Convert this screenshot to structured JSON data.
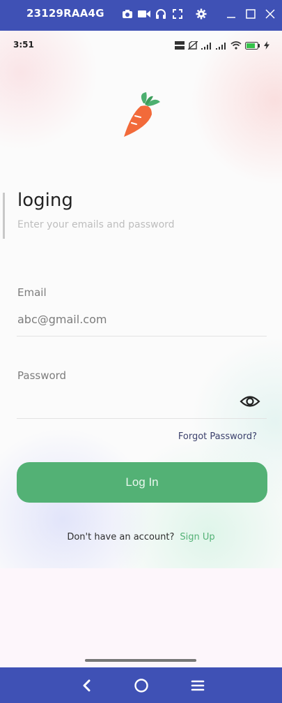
{
  "device": {
    "name": "23129RAA4G",
    "tools": [
      "camera-icon",
      "video-icon",
      "headset-icon",
      "fullscreen-icon",
      "settings-icon"
    ],
    "window_controls": [
      "minimize-icon",
      "maximize-icon",
      "close-icon"
    ]
  },
  "status_bar": {
    "time": "3:51",
    "icons": [
      "data-speed-icon",
      "sim-off-icon",
      "signal-icon",
      "signal-icon",
      "wifi-icon",
      "battery-icon",
      "charging-icon"
    ]
  },
  "login": {
    "logo": "carrot-icon",
    "title": "loging",
    "subtitle": "Enter your emails and password",
    "email_label": "Email",
    "email_value": "abc@gmail.com",
    "password_label": "Password",
    "password_value": "",
    "forgot_password": "Forgot Password?",
    "login_button": "Log In",
    "signup_prompt": "Don't have an account?",
    "signup_link": "Sign Up"
  },
  "nav_bar": {
    "buttons": [
      "back-icon",
      "home-icon",
      "menu-icon"
    ]
  },
  "colors": {
    "accent": "#53B175",
    "device_bar": "#3F51B5"
  }
}
